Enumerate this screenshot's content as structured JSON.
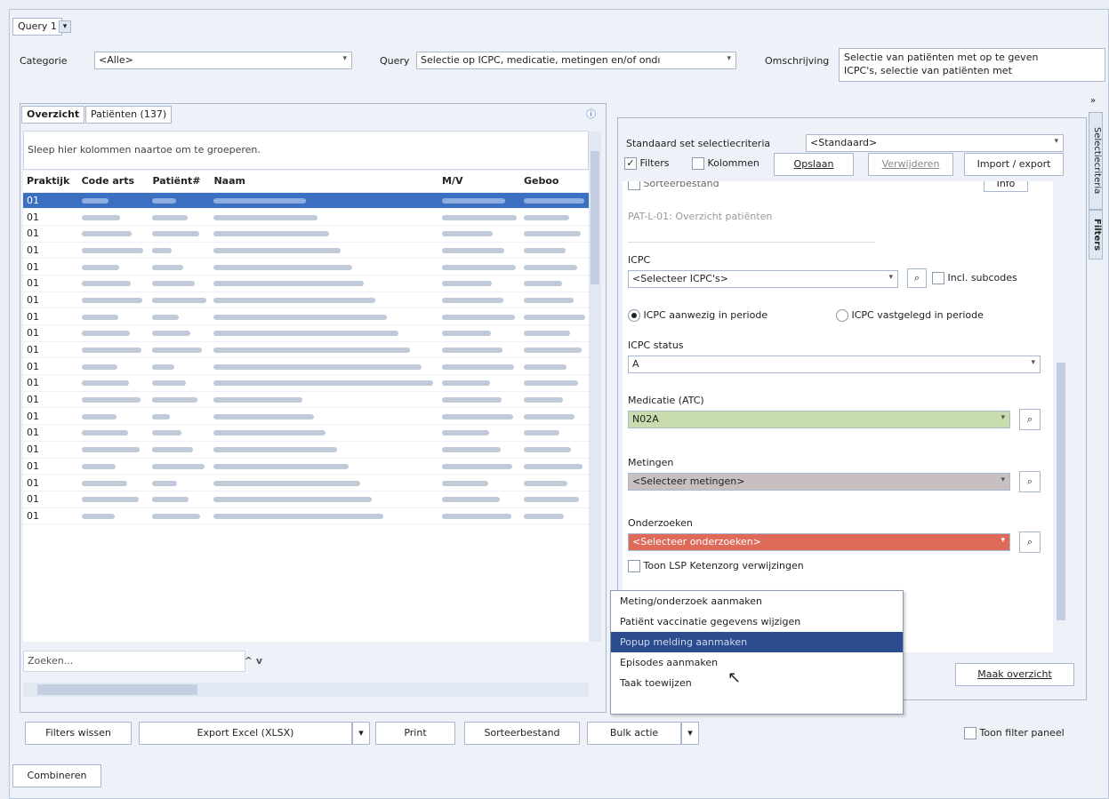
{
  "query_tab": {
    "label": "Query 1",
    "add_icon": "chevron-down"
  },
  "filters_top": {
    "categorie_label": "Categorie",
    "categorie_value": "<Alle>",
    "query_label": "Query",
    "query_value": "Selectie op ICPC, medicatie, metingen en/of ondı",
    "omschrijving_label": "Omschrijving",
    "omschrijving_line1": "Selectie van patiënten met op te geven",
    "omschrijving_line2": "ICPC's, selectie van patiënten met"
  },
  "left": {
    "tabs": [
      "Overzicht",
      "Patiënten (137)"
    ],
    "group_hint": "Sleep hier kolommen naartoe om te groeperen.",
    "columns": [
      "Praktijk",
      "Code arts",
      "Patiënt#",
      "Naam",
      "M/V",
      "Geboo"
    ],
    "rows": [
      "01",
      "01",
      "01",
      "01",
      "01",
      "01",
      "01",
      "01",
      "01",
      "01",
      "01",
      "01",
      "01",
      "01",
      "01",
      "01",
      "01",
      "01",
      "01",
      "01"
    ],
    "search_placeholder": "Zoeken...",
    "search_arrows": "^ v"
  },
  "right": {
    "standaard_label": "Standaard set selectiecriteria",
    "standaard_value": "<Standaard>",
    "filters_check": "Filters",
    "kolommen_check": "Kolommen",
    "opslaan": "Opslaan",
    "verwijderen": "Verwijderen",
    "import_export": "Import / export",
    "sorteerbestand": "Sorteerbestand",
    "info": "Info",
    "overzicht_ref": "PAT-L-01: Overzicht patiënten",
    "icpc_label": "ICPC",
    "icpc_value": "<Selecteer ICPC's>",
    "incl_subcodes": "Incl. subcodes",
    "radio1": "ICPC aanwezig in periode",
    "radio2": "ICPC vastgelegd in periode",
    "icpc_status_label": "ICPC status",
    "icpc_status_value": "A",
    "medicatie_label": "Medicatie (ATC)",
    "medicatie_value": "N02A",
    "metingen_label": "Metingen",
    "metingen_value": "<Selecteer metingen>",
    "onderzoeken_label": "Onderzoeken",
    "onderzoeken_value": "<Selecteer onderzoeken>",
    "toon_lsp": "Toon LSP Ketenzorg verwijzingen",
    "maak_overzicht": "Maak overzicht",
    "side_tabs": [
      "Selectiecriteria",
      "Filters"
    ],
    "colors": {
      "icpc": "#b7cbe6",
      "medicatie": "#c9dcae",
      "metingen": "#c8c0c0",
      "onderzoeken": "#e06a5a"
    }
  },
  "menu": {
    "items": [
      "Meting/onderzoek aanmaken",
      "Patiënt vaccinatie gegevens wijzigen",
      "Popup melding aanmaken",
      "Episodes aanmaken",
      "Taak toewijzen"
    ],
    "highlighted_index": 2
  },
  "bottom": {
    "filters_wissen": "Filters wissen",
    "export_excel": "Export Excel (XLSX)",
    "print": "Print",
    "sorteerbestand": "Sorteerbestand",
    "bulk_actie": "Bulk actie",
    "toon_filter": "Toon filter paneel",
    "combineren": "Combineren"
  }
}
